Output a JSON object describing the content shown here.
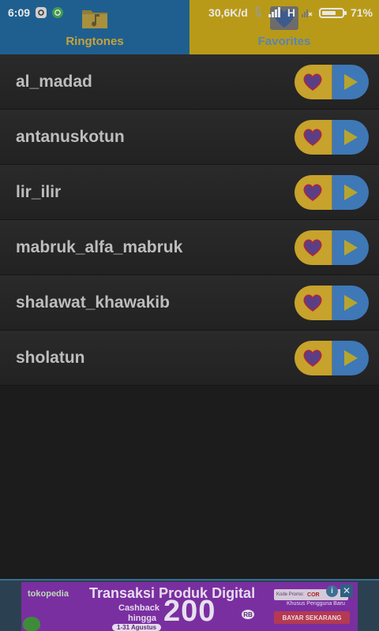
{
  "status_bar": {
    "time": "6:09",
    "network_speed": "30,6K/d",
    "network_type": "H",
    "battery": "71%",
    "battery_level": 0.71,
    "icons": [
      "notification-icon",
      "whatsapp-icon",
      "data-transfer-icon",
      "signal-icon",
      "no-signal-icon",
      "battery-icon"
    ]
  },
  "tabs": [
    {
      "label": "Ringtones",
      "icon": "folder-music-icon",
      "color": "#1f5f8f"
    },
    {
      "label": "Favorites",
      "icon": "heart-icon",
      "color": "#b99a18"
    }
  ],
  "ringtones": [
    {
      "label": "al_madad"
    },
    {
      "label": "antanuskotun"
    },
    {
      "label": "lir_ilir"
    },
    {
      "label": "mabruk_alfa_mabruk"
    },
    {
      "label": "shalawat_khawakib"
    },
    {
      "label": "sholatun"
    }
  ],
  "row_actions": {
    "favorite_icon": "heart-icon",
    "play_icon": "play-icon",
    "favorite_color": "#c7a22c",
    "play_color": "#3e78b6"
  },
  "ad": {
    "brand": "tokopedia",
    "title": "Transaksi Produk Digital",
    "cashback": "Cashback",
    "hingga": "hingga",
    "amount": "200",
    "amount_unit": "RB",
    "date": "1-31 Agustus",
    "promo_label": "Kode Promo:",
    "promo_code": "COR",
    "sub": "Khusus Pengguna Baru",
    "cta": "BAYAR SEKARANG",
    "info": "i",
    "close": "✕"
  }
}
